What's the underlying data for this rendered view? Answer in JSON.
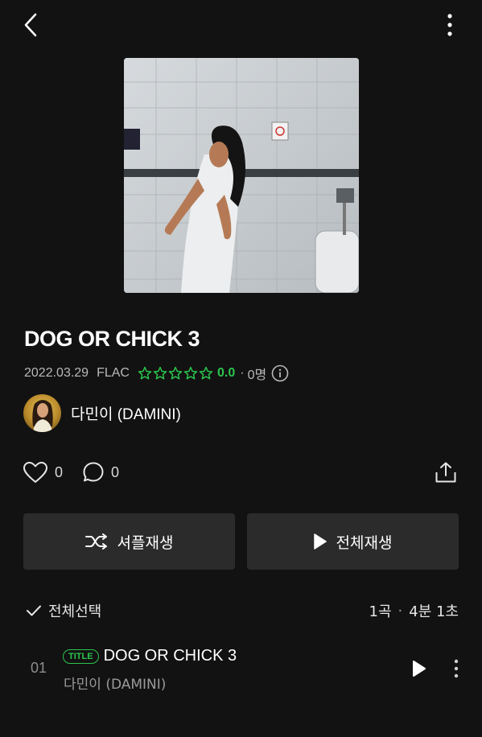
{
  "header": {
    "back_icon": "chevron-left-icon",
    "more_icon": "vertical-dots-icon"
  },
  "album": {
    "title": "DOG OR CHICK 3",
    "release_date": "2022.03.29",
    "format": "FLAC",
    "rating": "0.0",
    "rating_stars": 0,
    "rating_count_prefix": "·",
    "rating_count": "0명",
    "colors": {
      "accent": "#2bc44d",
      "background": "#121212",
      "button": "#2b2b2b"
    }
  },
  "artist": {
    "name": "다민이 (DAMINI)"
  },
  "social": {
    "likes": "0",
    "comments": "0"
  },
  "buttons": {
    "shuffle": "셔플재생",
    "play_all": "전체재생"
  },
  "list": {
    "select_all": "전체선택",
    "track_count": "1곡",
    "separator": "·",
    "duration": "4분 1초"
  },
  "tracks": [
    {
      "number": "01",
      "badge": "TITLE",
      "title": "DOG OR CHICK 3",
      "artist": "다민이 (DAMINI)"
    }
  ]
}
